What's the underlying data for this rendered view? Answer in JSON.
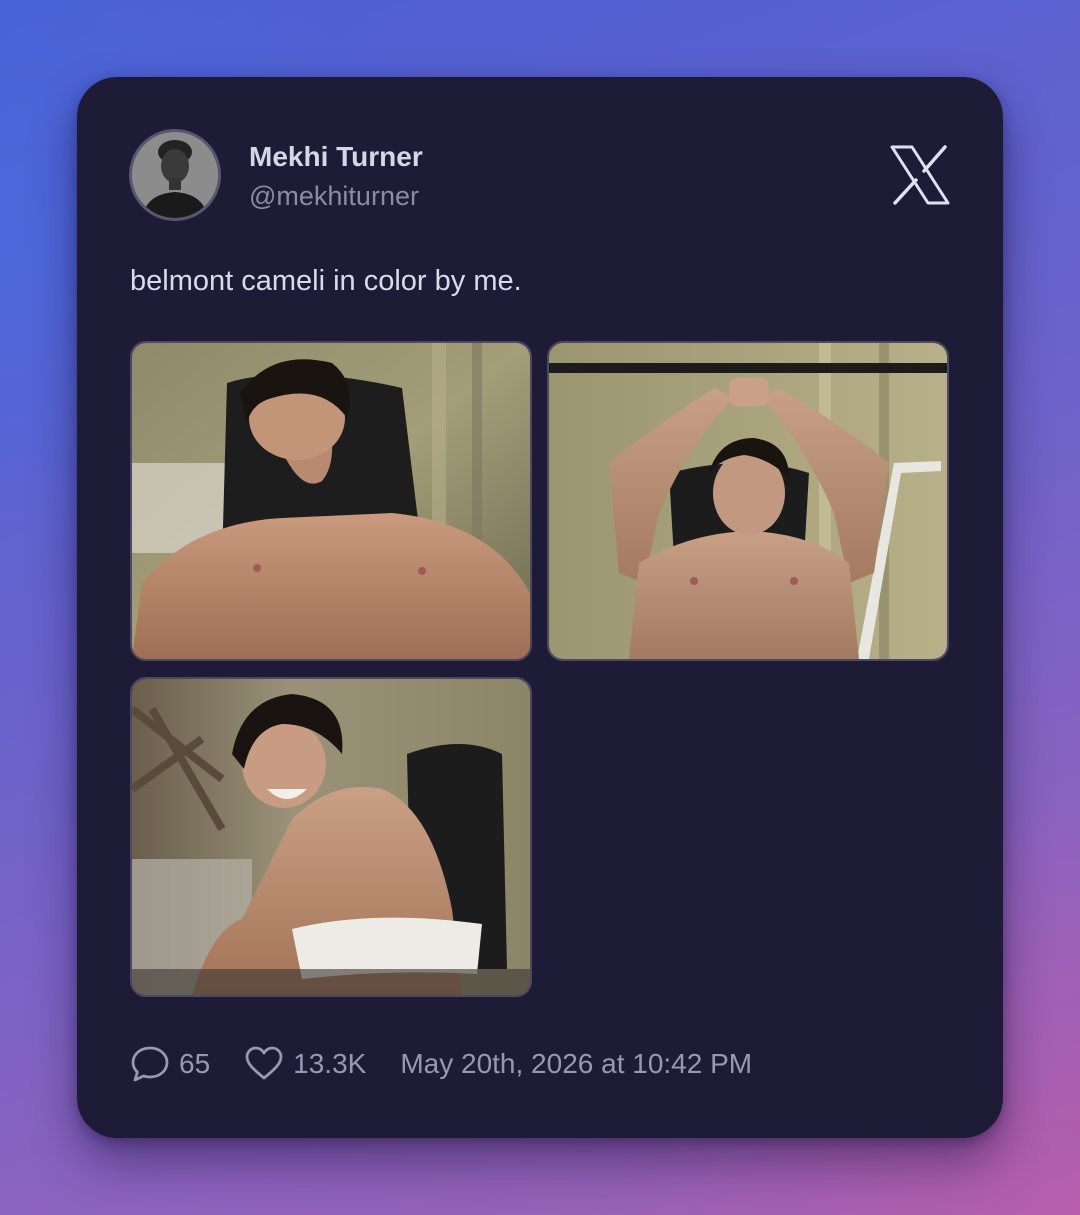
{
  "author": {
    "name": "Mekhi Turner",
    "handle": "@mekhiturner"
  },
  "platform_icon": "x-logo-icon",
  "post": {
    "text": "belmont cameli in color by me.",
    "images": [
      "photo: shirtless man reclining on a gym bench",
      "photo: shirtless man gripping an overhead bar",
      "photo: shirtless man smiling, seated on a gym bench"
    ]
  },
  "stats": {
    "replies": "65",
    "likes": "13.3K",
    "timestamp": "May 20th, 2026 at 10:42 PM"
  },
  "icons": {
    "reply": "speech-bubble-icon",
    "like": "heart-icon"
  },
  "colors": {
    "card_background": "#1e1b37",
    "primary_text": "#d8d6e4",
    "secondary_text": "#8d8aa6",
    "photo_border": "#4d4963"
  }
}
